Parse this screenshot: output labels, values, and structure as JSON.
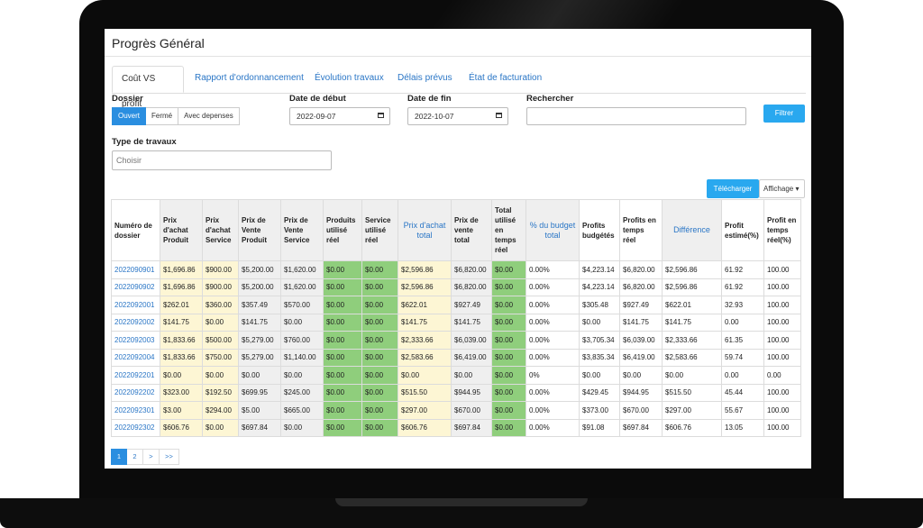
{
  "page": {
    "title": "Progrès Général"
  },
  "tabs": [
    {
      "label": "Coût VS profit"
    },
    {
      "label": "Rapport d'ordonnancement"
    },
    {
      "label": "Évolution travaux"
    },
    {
      "label": "Délais prévus"
    },
    {
      "label": "État de facturation"
    }
  ],
  "filters": {
    "dossier_label": "Dossier",
    "dossier_options": [
      "Ouvert",
      "Fermé",
      "Avec depenses"
    ],
    "date_debut_label": "Date de début",
    "date_debut_value": "2022-09-07",
    "date_fin_label": "Date de fin",
    "date_fin_value": "2022-10-07",
    "search_label": "Rechercher",
    "search_value": "",
    "filter_button": "Filtrer",
    "type_label": "Type de travaux",
    "type_placeholder": "Choisir"
  },
  "toolbar": {
    "download": "Télécharger",
    "display": "Affichage"
  },
  "table": {
    "headers": [
      "Numéro de dossier",
      "Prix d'achat Produit",
      "Prix d'achat Service",
      "Prix de Vente Produit",
      "Prix de Vente Service",
      "Produits utilisé réel",
      "Service utilisé réel",
      "Prix d'achat total",
      "Prix de vente total",
      "Total utilisé en temps réel",
      "% du budget total",
      "Profits budgétés",
      "Profits en temps réel",
      "Différence",
      "Profit estimé(%)",
      "Profit en temps réel(%)"
    ],
    "rows": [
      [
        "2022090901",
        "$1,696.86",
        "$900.00",
        "$5,200.00",
        "$1,620.00",
        "$0.00",
        "$0.00",
        "$2,596.86",
        "$6,820.00",
        "$0.00",
        "0.00%",
        "$4,223.14",
        "$6,820.00",
        "$2,596.86",
        "61.92",
        "100.00"
      ],
      [
        "2022090902",
        "$1,696.86",
        "$900.00",
        "$5,200.00",
        "$1,620.00",
        "$0.00",
        "$0.00",
        "$2,596.86",
        "$6,820.00",
        "$0.00",
        "0.00%",
        "$4,223.14",
        "$6,820.00",
        "$2,596.86",
        "61.92",
        "100.00"
      ],
      [
        "2022092001",
        "$262.01",
        "$360.00",
        "$357.49",
        "$570.00",
        "$0.00",
        "$0.00",
        "$622.01",
        "$927.49",
        "$0.00",
        "0.00%",
        "$305.48",
        "$927.49",
        "$622.01",
        "32.93",
        "100.00"
      ],
      [
        "2022092002",
        "$141.75",
        "$0.00",
        "$141.75",
        "$0.00",
        "$0.00",
        "$0.00",
        "$141.75",
        "$141.75",
        "$0.00",
        "0.00%",
        "$0.00",
        "$141.75",
        "$141.75",
        "0.00",
        "100.00"
      ],
      [
        "2022092003",
        "$1,833.66",
        "$500.00",
        "$5,279.00",
        "$760.00",
        "$0.00",
        "$0.00",
        "$2,333.66",
        "$6,039.00",
        "$0.00",
        "0.00%",
        "$3,705.34",
        "$6,039.00",
        "$2,333.66",
        "61.35",
        "100.00"
      ],
      [
        "2022092004",
        "$1,833.66",
        "$750.00",
        "$5,279.00",
        "$1,140.00",
        "$0.00",
        "$0.00",
        "$2,583.66",
        "$6,419.00",
        "$0.00",
        "0.00%",
        "$3,835.34",
        "$6,419.00",
        "$2,583.66",
        "59.74",
        "100.00"
      ],
      [
        "2022092201",
        "$0.00",
        "$0.00",
        "$0.00",
        "$0.00",
        "$0.00",
        "$0.00",
        "$0.00",
        "$0.00",
        "$0.00",
        "0%",
        "$0.00",
        "$0.00",
        "$0.00",
        "0.00",
        "0.00"
      ],
      [
        "2022092202",
        "$323.00",
        "$192.50",
        "$699.95",
        "$245.00",
        "$0.00",
        "$0.00",
        "$515.50",
        "$944.95",
        "$0.00",
        "0.00%",
        "$429.45",
        "$944.95",
        "$515.50",
        "45.44",
        "100.00"
      ],
      [
        "2022092301",
        "$3.00",
        "$294.00",
        "$5.00",
        "$665.00",
        "$0.00",
        "$0.00",
        "$297.00",
        "$670.00",
        "$0.00",
        "0.00%",
        "$373.00",
        "$670.00",
        "$297.00",
        "55.67",
        "100.00"
      ],
      [
        "2022092302",
        "$606.76",
        "$0.00",
        "$697.84",
        "$0.00",
        "$0.00",
        "$0.00",
        "$606.76",
        "$697.84",
        "$0.00",
        "0.00%",
        "$91.08",
        "$697.84",
        "$606.76",
        "13.05",
        "100.00"
      ]
    ]
  },
  "pagination": [
    "1",
    "2",
    ">",
    ">>"
  ],
  "colors": {
    "accent": "#2a8ee0",
    "link": "#2a76c6",
    "yellow_cell": "#fdf6d4",
    "green_cell": "#8fce7c",
    "grey_cell": "#efefef"
  }
}
